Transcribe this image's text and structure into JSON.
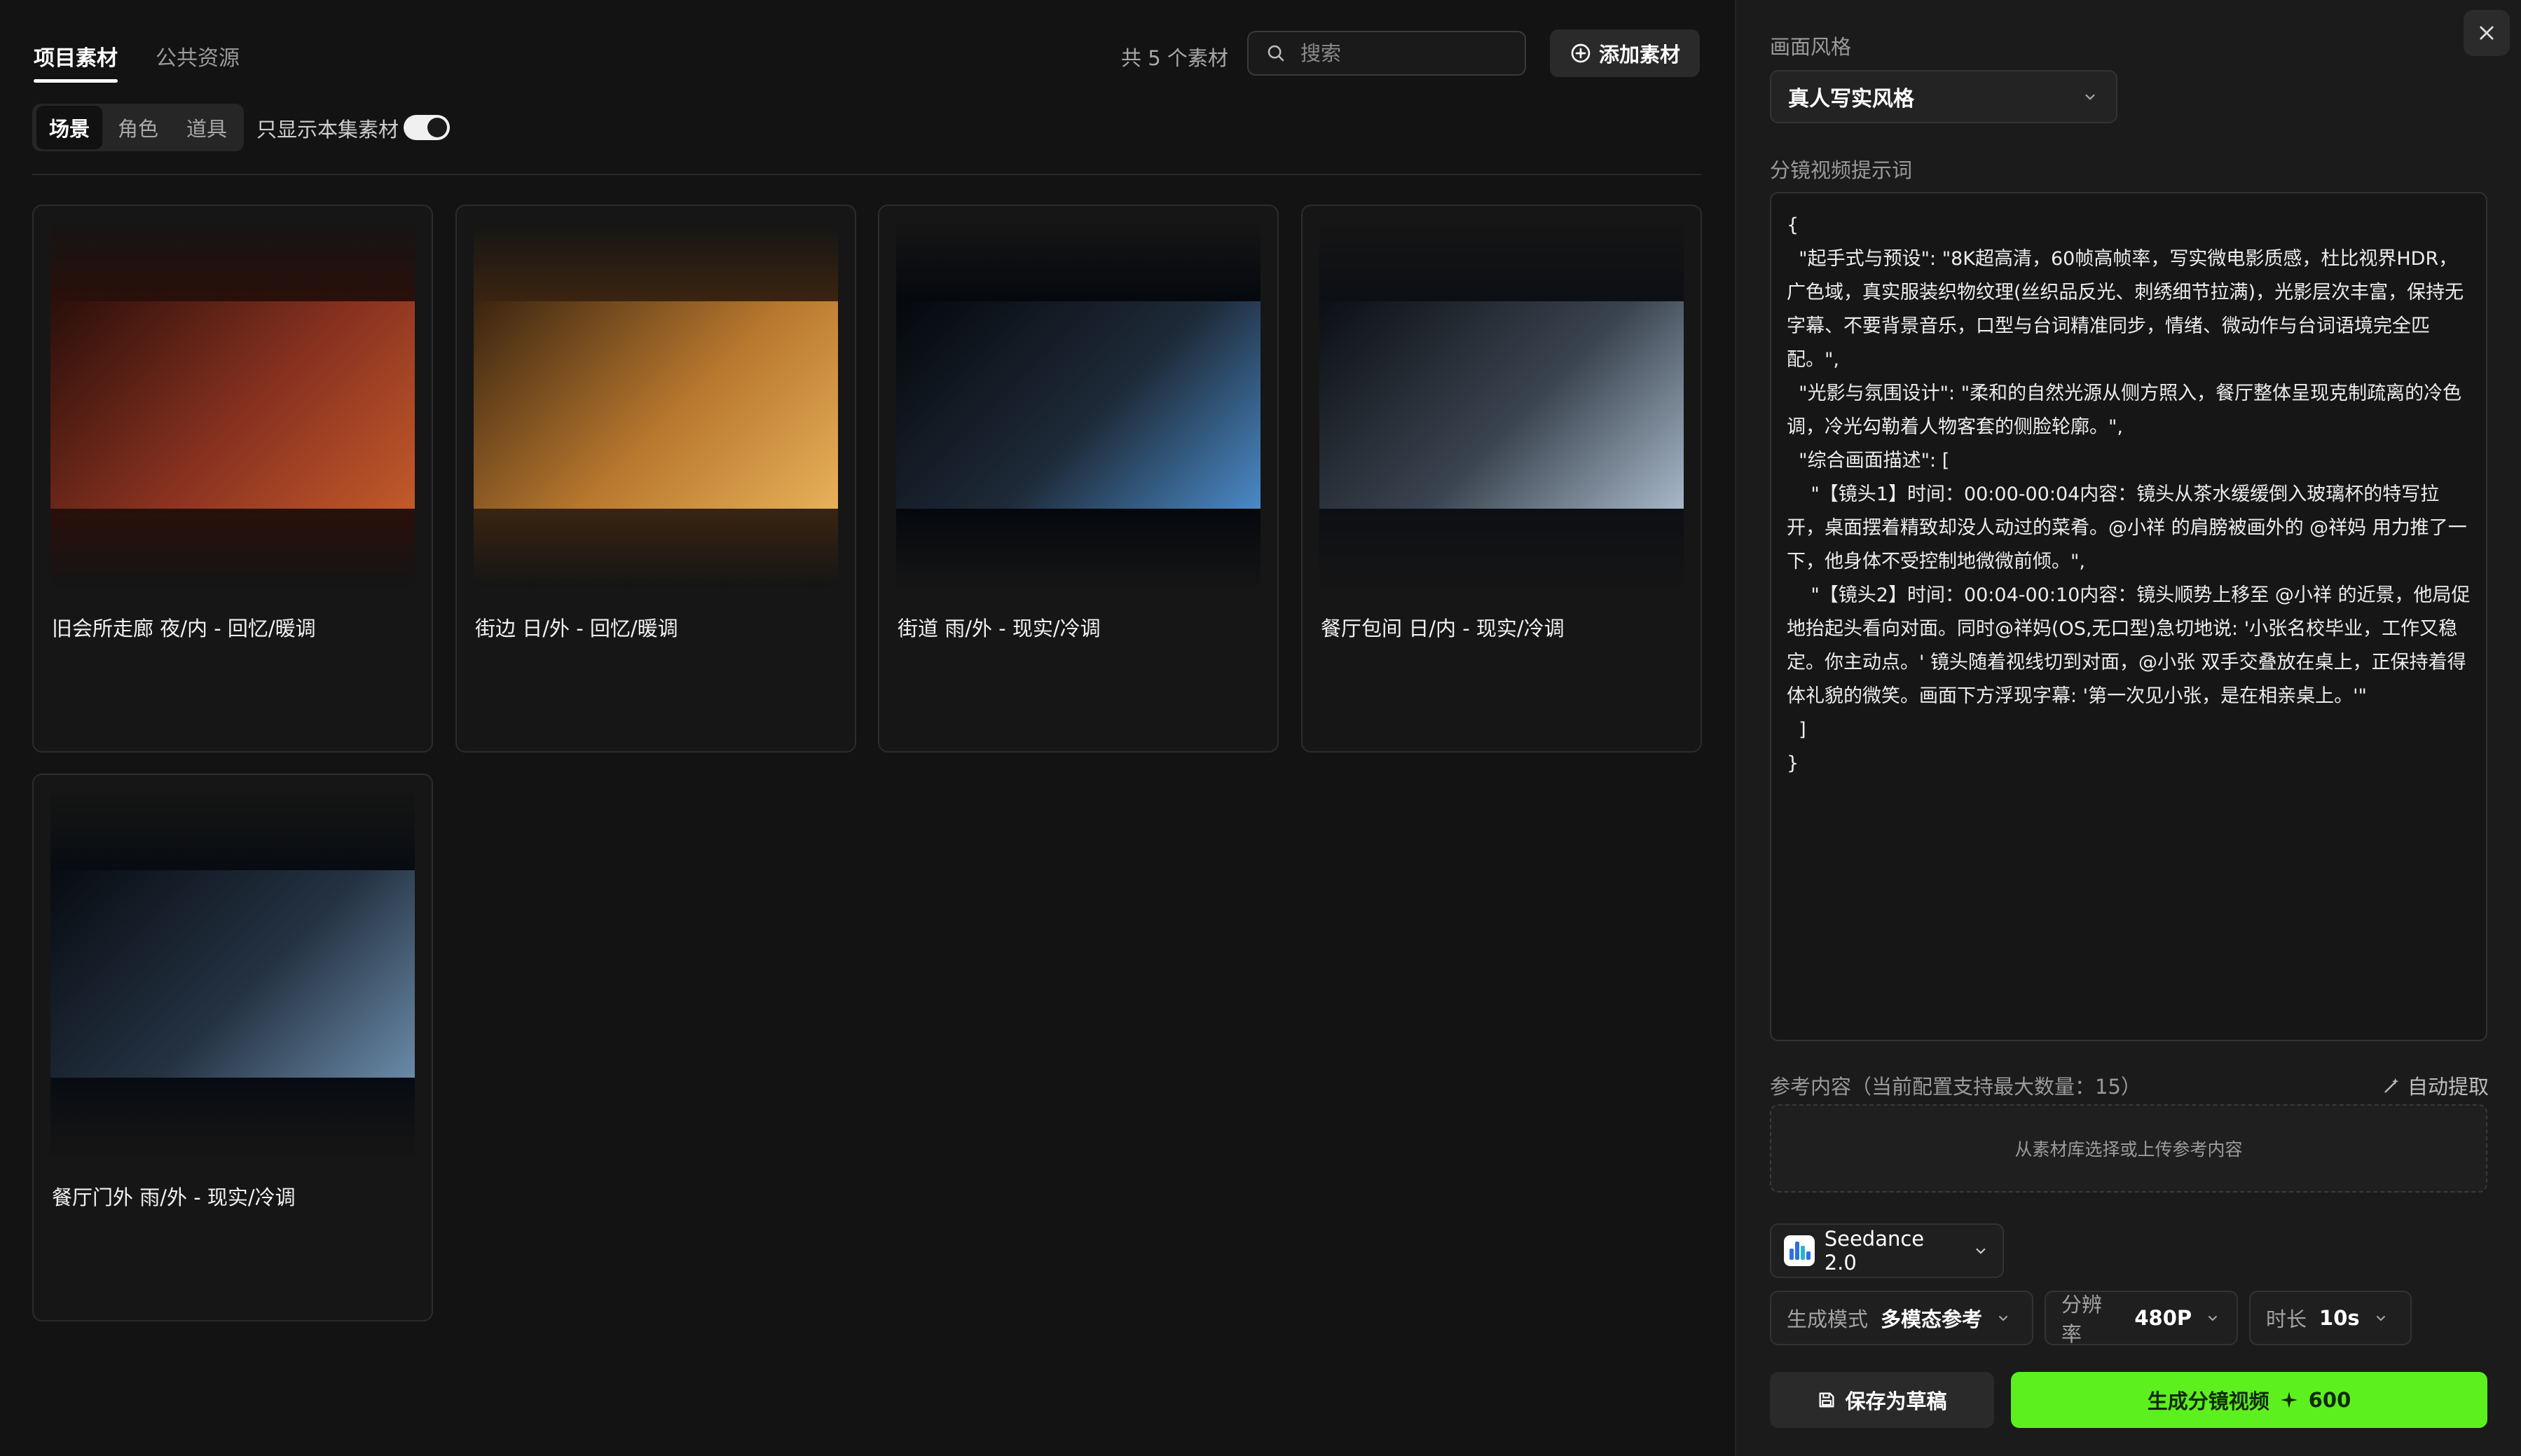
{
  "tabs": [
    {
      "label": "项目素材",
      "active": true
    },
    {
      "label": "公共资源",
      "active": false
    }
  ],
  "toolbar": {
    "count_text": "共 5 个素材",
    "search_placeholder": "搜索",
    "search_icon": "search-icon",
    "add_label": "添加素材",
    "add_icon": "plus-circle-icon"
  },
  "segments": [
    {
      "label": "场景",
      "active": true
    },
    {
      "label": "角色",
      "active": false
    },
    {
      "label": "道具",
      "active": false
    }
  ],
  "filter": {
    "only_label": "只显示本集素材",
    "enabled": true
  },
  "cards": [
    {
      "title": "旧会所走廊 夜/内 - 回忆/暖调",
      "palette": [
        "#2a0f0a",
        "#8a3220",
        "#c25a2a"
      ]
    },
    {
      "title": "街边 日/外 - 回忆/暖调",
      "palette": [
        "#3a2410",
        "#b8782e",
        "#e8b15a"
      ]
    },
    {
      "title": "街道 雨/外 - 现实/冷调",
      "palette": [
        "#05080d",
        "#1e2a38",
        "#4a8ac8"
      ]
    },
    {
      "title": "餐厅包间 日/内 - 现实/冷调",
      "palette": [
        "#0c0f14",
        "#3a4450",
        "#a8b8c8"
      ]
    },
    {
      "title": "餐厅门外 雨/外 - 现实/冷调",
      "palette": [
        "#080c12",
        "#243242",
        "#6a8aa8"
      ]
    }
  ],
  "panel": {
    "style_label": "画面风格",
    "style_value": "真人写实风格",
    "prompt_label": "分镜视频提示词",
    "prompt_text": "{\n  \"起手式与预设\": \"8K超高清，60帧高帧率，写实微电影质感，杜比视界HDR，广色域，真实服装织物纹理(丝织品反光、刺绣细节拉满)，光影层次丰富，保持无字幕、不要背景音乐，口型与台词精准同步，情绪、微动作与台词语境完全匹配。\",\n  \"光影与氛围设计\": \"柔和的自然光源从侧方照入，餐厅整体呈现克制疏离的冷色调，冷光勾勒着人物客套的侧脸轮廓。\",\n  \"综合画面描述\": [\n    \"【镜头1】时间：00:00-00:04内容：镜头从茶水缓缓倒入玻璃杯的特写拉开，桌面摆着精致却没人动过的菜肴。@小祥 的肩膀被画外的 @祥妈 用力推了一下，他身体不受控制地微微前倾。\",\n    \"【镜头2】时间：00:04-00:10内容：镜头顺势上移至 @小祥 的近景，他局促地抬起头看向对面。同时@祥妈(OS,无口型)急切地说: '小张名校毕业，工作又稳定。你主动点。' 镜头随着视线切到对面，@小张 双手交叠放在桌上，正保持着得体礼貌的微笑。画面下方浮现字幕: '第一次见小张，是在相亲桌上。'\"\n  ]\n}",
    "ref_label": "参考内容（当前配置支持最大数量：15）",
    "auto_extract": "自动提取",
    "upload_hint": "从素材库选择或上传参考内容",
    "model": "Seedance 2.0",
    "mode_key": "生成模式",
    "mode_value": "多模态参考",
    "res_key": "分辨率",
    "res_value": "480P",
    "dur_key": "时长",
    "dur_value": "10s",
    "save_label": "保存为草稿",
    "gen_label": "生成分镜视频",
    "gen_cost": "600",
    "accent_color": "#5df01f"
  }
}
